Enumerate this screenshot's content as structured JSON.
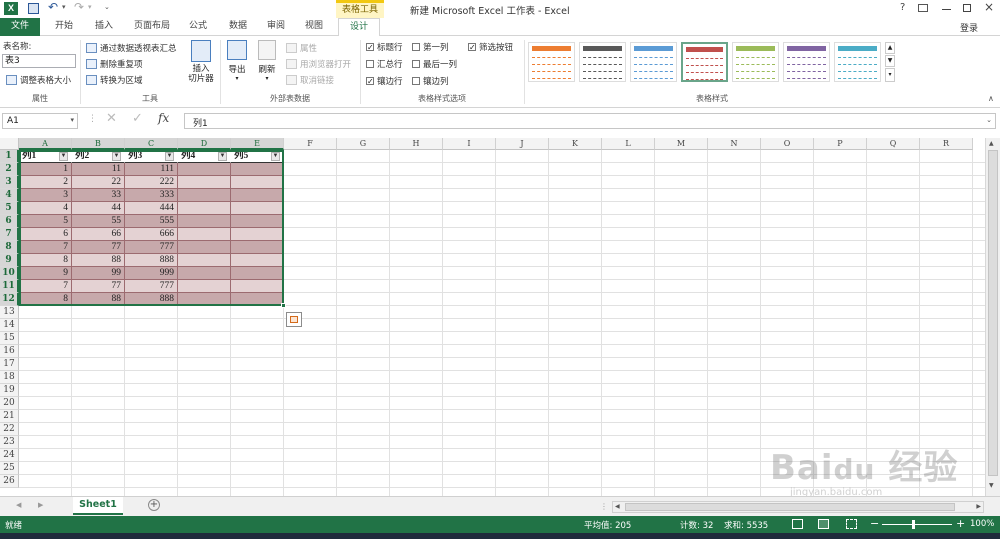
{
  "window": {
    "title": "新建 Microsoft Excel 工作表 - Excel",
    "context_tab_group": "表格工具",
    "help": "?",
    "login": "登录",
    "accent": "#217346"
  },
  "tabs": [
    "文件",
    "开始",
    "插入",
    "页面布局",
    "公式",
    "数据",
    "审阅",
    "视图",
    "设计"
  ],
  "ribbon": {
    "properties": {
      "name_label": "表名称:",
      "name_value": "表3",
      "resize": "调整表格大小",
      "group": "属性"
    },
    "tools": {
      "pivot": "通过数据透视表汇总",
      "remove_dup": "删除重复项",
      "to_range": "转换为区域",
      "slicer": "插入\n切片器",
      "group": "工具"
    },
    "external": {
      "export": "导出",
      "refresh": "刷新",
      "properties": "属性",
      "open_browser": "用浏览器打开",
      "unlink": "取消链接",
      "group": "外部表数据"
    },
    "style_options": {
      "items": [
        {
          "label": "标题行",
          "checked": true
        },
        {
          "label": "第一列",
          "checked": false
        },
        {
          "label": "筛选按钮",
          "checked": true
        },
        {
          "label": "汇总行",
          "checked": false
        },
        {
          "label": "最后一列",
          "checked": false
        },
        {
          "label": "镶边行",
          "checked": true
        },
        {
          "label": "镶边列",
          "checked": false
        }
      ],
      "group": "表格样式选项"
    },
    "table_styles": {
      "group": "表格样式",
      "colors": [
        "#ed7d31",
        "#595959",
        "#5b9bd5",
        "#c0504d",
        "#9bbb59",
        "#8064a2",
        "#4bacc6"
      ]
    }
  },
  "formula_bar": {
    "name_box": "A1",
    "fx": "fx",
    "content": "列1"
  },
  "grid": {
    "columns": [
      "A",
      "B",
      "C",
      "D",
      "E",
      "F",
      "G",
      "H",
      "I",
      "J",
      "K",
      "L",
      "M",
      "N",
      "O",
      "P",
      "Q",
      "R"
    ],
    "rows": [
      "1",
      "2",
      "3",
      "4",
      "5",
      "6",
      "7",
      "8",
      "9",
      "10",
      "11",
      "12",
      "13",
      "14",
      "15",
      "16",
      "17",
      "18",
      "19",
      "20",
      "21",
      "22",
      "23",
      "24",
      "25",
      "26"
    ],
    "table_headers": [
      "列1",
      "列2",
      "列3",
      "列4",
      "列5"
    ],
    "table_rows": [
      [
        "1",
        "11",
        "111",
        "",
        ""
      ],
      [
        "2",
        "22",
        "222",
        "",
        ""
      ],
      [
        "3",
        "33",
        "333",
        "",
        ""
      ],
      [
        "4",
        "44",
        "444",
        "",
        ""
      ],
      [
        "5",
        "55",
        "555",
        "",
        ""
      ],
      [
        "6",
        "66",
        "666",
        "",
        ""
      ],
      [
        "7",
        "77",
        "777",
        "",
        ""
      ],
      [
        "8",
        "88",
        "888",
        "",
        ""
      ],
      [
        "9",
        "99",
        "999",
        "",
        ""
      ],
      [
        "7",
        "77",
        "777",
        "",
        ""
      ],
      [
        "8",
        "88",
        "888",
        "",
        ""
      ],
      [
        "",
        "",
        "",
        "",
        ""
      ],
      [
        "",
        "",
        "",
        "",
        ""
      ]
    ]
  },
  "sheets": {
    "tabs": [
      "Sheet1"
    ],
    "add": "+"
  },
  "status": {
    "mode": "就绪",
    "average": "平均值: 205",
    "count": "计数: 32",
    "sum": "求和: 5535",
    "zoom": "100%",
    "zoom_minus": "−",
    "zoom_plus": "+"
  },
  "watermark": "Baidu经验 jingyan.baidu.com"
}
